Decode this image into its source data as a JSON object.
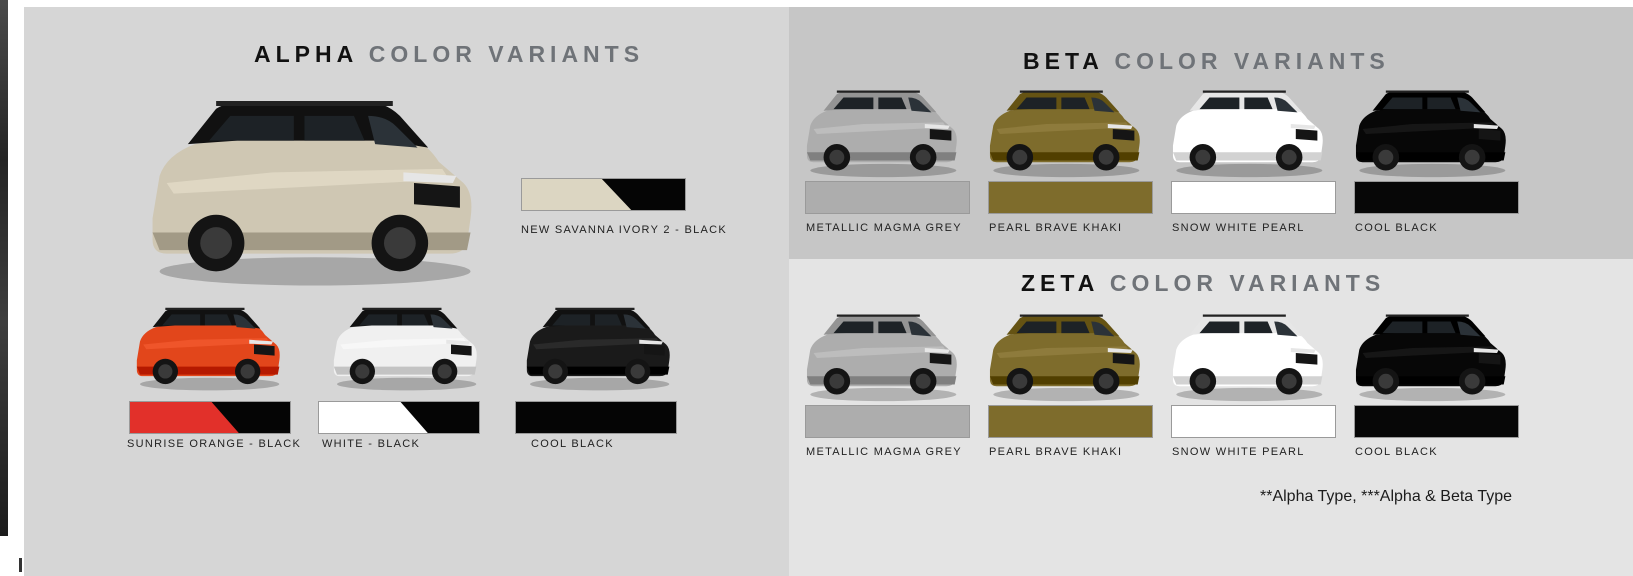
{
  "alpha": {
    "heading_lead": "ALPHA",
    "heading_rest": "COLOR VARIANTS",
    "variants": [
      {
        "label": "NEW SAVANNA IVORY 2 - BLACK",
        "body_color": "#cfc7b3",
        "roof_color": "#111111"
      },
      {
        "label": "SUNRISE ORANGE - BLACK",
        "body_color": "#e2461b",
        "roof_color": "#111111"
      },
      {
        "label": "WHITE - BLACK",
        "body_color": "#f0f0f0",
        "roof_color": "#111111"
      },
      {
        "label": "COOL BLACK",
        "body_color": "#1a1a1a",
        "roof_color": "#111111"
      }
    ],
    "swatch_colors": {
      "ivory": "#dcd6c2",
      "orange": "#e2302a",
      "white": "#ffffff",
      "black": "#050505"
    }
  },
  "beta": {
    "heading_lead": "BETA",
    "heading_rest": "COLOR VARIANTS",
    "variants": [
      {
        "label": "METALLIC MAGMA GREY",
        "color": "#adadad"
      },
      {
        "label": "PEARL BRAVE KHAKI",
        "color": "#7e6c2c"
      },
      {
        "label": "SNOW WHITE PEARL",
        "color": "#ffffff"
      },
      {
        "label": "COOL BLACK",
        "color": "#070707"
      }
    ]
  },
  "zeta": {
    "heading_lead": "ZETA",
    "heading_rest": "COLOR VARIANTS",
    "variants": [
      {
        "label": "METALLIC MAGMA GREY",
        "color": "#adadad"
      },
      {
        "label": "PEARL BRAVE KHAKI",
        "color": "#7e6c2c"
      },
      {
        "label": "SNOW WHITE PEARL",
        "color": "#ffffff"
      },
      {
        "label": "COOL BLACK",
        "color": "#070707"
      }
    ]
  },
  "footnote": "**Alpha Type, ***Alpha & Beta Type"
}
